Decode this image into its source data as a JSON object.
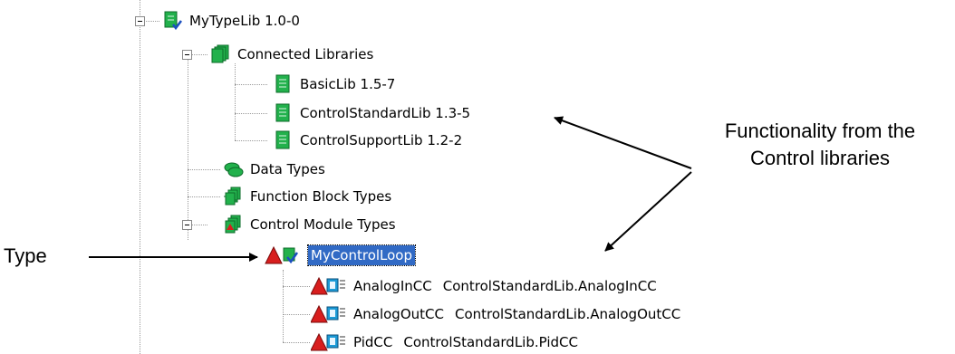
{
  "tree": {
    "root": {
      "label": "MyTypeLib 1.0-0",
      "icon": "library-checked-icon"
    },
    "connected": {
      "label": "Connected Libraries",
      "icon": "libraries-icon"
    },
    "libs": [
      {
        "label": "BasicLib 1.5-7",
        "icon": "library-icon"
      },
      {
        "label": "ControlStandardLib 1.3-5",
        "icon": "library-icon"
      },
      {
        "label": "ControlSupportLib 1.2-2",
        "icon": "library-icon"
      }
    ],
    "data_types": {
      "label": "Data Types",
      "icon": "data-types-icon"
    },
    "fb_types": {
      "label": "Function Block Types",
      "icon": "function-block-types-icon"
    },
    "cm_types": {
      "label": "Control Module Types",
      "icon": "control-module-types-icon"
    },
    "selected": {
      "label": "MyControlLoop",
      "icon": "control-module-checked-icon"
    },
    "children": [
      {
        "name": "AnalogInCC",
        "type": "ControlStandardLib.AnalogInCC",
        "icon": "control-module-instance-icon"
      },
      {
        "name": "AnalogOutCC",
        "type": "ControlStandardLib.AnalogOutCC",
        "icon": "control-module-instance-icon"
      },
      {
        "name": "PidCC",
        "type": "ControlStandardLib.PidCC",
        "icon": "control-module-instance-icon"
      }
    ]
  },
  "annotations": {
    "functionality_line1": "Functionality from the",
    "functionality_line2": "Control libraries",
    "type_label": "Type"
  },
  "colors": {
    "selection": "#316ac5",
    "library_green": "#22b14c",
    "triangle_red": "#d81e1e"
  }
}
